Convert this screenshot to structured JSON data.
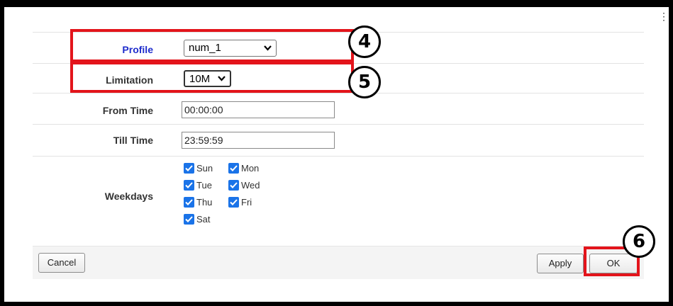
{
  "form": {
    "profile": {
      "label": "Profile",
      "value": "num_1"
    },
    "limitation": {
      "label": "Limitation",
      "value": "10M"
    },
    "from_time": {
      "label": "From Time",
      "value": "00:00:00"
    },
    "till_time": {
      "label": "Till Time",
      "value": "23:59:59"
    },
    "weekdays": {
      "label": "Weekdays",
      "days": [
        {
          "name": "Sun",
          "checked": true
        },
        {
          "name": "Mon",
          "checked": true
        },
        {
          "name": "Tue",
          "checked": true
        },
        {
          "name": "Wed",
          "checked": true
        },
        {
          "name": "Thu",
          "checked": true
        },
        {
          "name": "Fri",
          "checked": true
        },
        {
          "name": "Sat",
          "checked": true
        }
      ]
    }
  },
  "footer": {
    "cancel_label": "Cancel",
    "apply_label": "Apply",
    "ok_label": "OK"
  },
  "annotations": {
    "step_4": "4",
    "step_5": "5",
    "step_6": "6",
    "highlight_color": "#e3141b"
  },
  "colors": {
    "checkbox": "#1a73e8",
    "profile_label": "#1f2dcc"
  }
}
